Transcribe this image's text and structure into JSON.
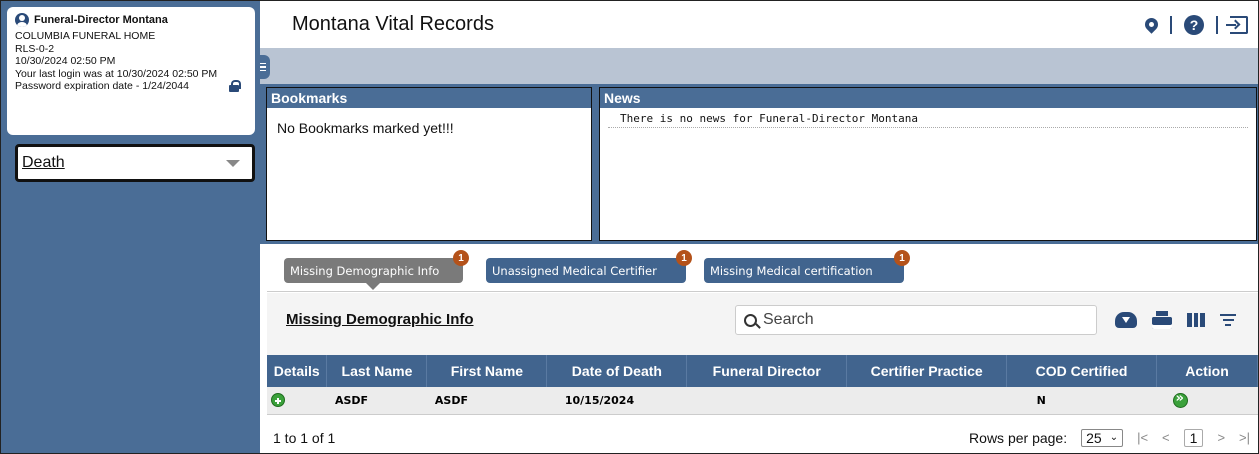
{
  "user": {
    "name": "Funeral-Director Montana",
    "org": "COLUMBIA FUNERAL HOME",
    "code": "RLS-0-2",
    "timestamp": "10/30/2024 02:50 PM",
    "last_login": "Your last login was at 10/30/2024 02:50 PM",
    "password_expiration": "Password expiration date - 1/24/2044"
  },
  "module_select": {
    "value": "Death"
  },
  "header": {
    "title": "Montana Vital Records",
    "help_glyph": "?"
  },
  "bookmarks": {
    "title": "Bookmarks",
    "message": "No Bookmarks marked yet!!!"
  },
  "news": {
    "title": "News",
    "message": "There is no news for Funeral-Director Montana"
  },
  "tabs": [
    {
      "label": "Missing Demographic Info",
      "badge": "1",
      "active": true
    },
    {
      "label": "Unassigned Medical Certifier",
      "badge": "1",
      "active": false
    },
    {
      "label": "Missing Medical certification",
      "badge": "1",
      "active": false
    }
  ],
  "grid": {
    "title": "Missing Demographic Info",
    "search_placeholder": "Search",
    "columns": [
      "Details",
      "Last Name",
      "First Name",
      "Date of Death",
      "Funeral Director",
      "Certifier Practice",
      "COD Certified",
      "Action"
    ],
    "rows": [
      {
        "last_name": "ASDF",
        "first_name": "ASDF",
        "date_of_death": "10/15/2024",
        "funeral_director": "",
        "certifier_practice": "",
        "cod_certified": "N"
      }
    ]
  },
  "footer": {
    "count": "1 to 1 of 1",
    "rows_per_page_label": "Rows per page:",
    "rows_per_page_value": "25",
    "current_page": "1"
  },
  "colors": {
    "sidebar": "#4a6d96",
    "table_header": "#41648e",
    "badge": "#b4521a",
    "action_green": "#3ba13b"
  }
}
